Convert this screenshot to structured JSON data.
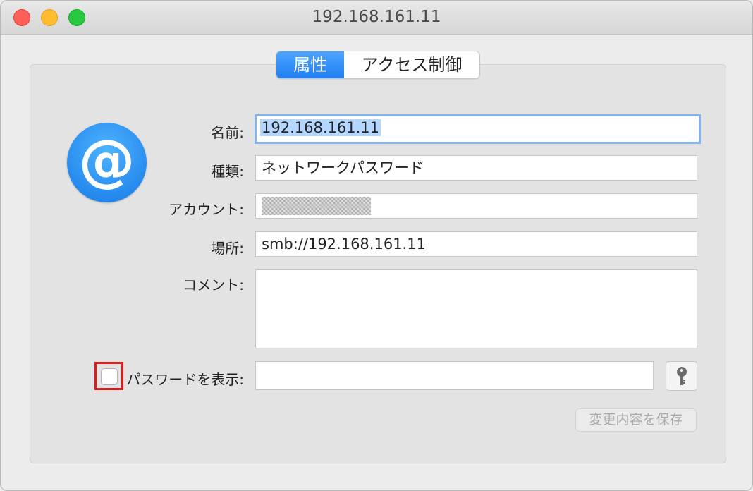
{
  "window": {
    "title": "192.168.161.11"
  },
  "tabs": [
    {
      "label": "属性",
      "active": true
    },
    {
      "label": "アクセス制御",
      "active": false
    }
  ],
  "icon": {
    "name": "at-sign-icon",
    "glyph": "@"
  },
  "fields": {
    "name": {
      "label": "名前:",
      "value": "192.168.161.11"
    },
    "kind": {
      "label": "種類:",
      "value": "ネットワークパスワード"
    },
    "account": {
      "label": "アカウント:",
      "value": ""
    },
    "where": {
      "label": "場所:",
      "value": "smb://192.168.161.11"
    },
    "comments": {
      "label": "コメント:",
      "value": ""
    },
    "show_password": {
      "label": "パスワードを表示:",
      "checked": false,
      "value": ""
    }
  },
  "buttons": {
    "save_label": "変更内容を保存"
  },
  "colors": {
    "accent": "#1f7ff2",
    "highlight_box": "#e01b1b"
  }
}
